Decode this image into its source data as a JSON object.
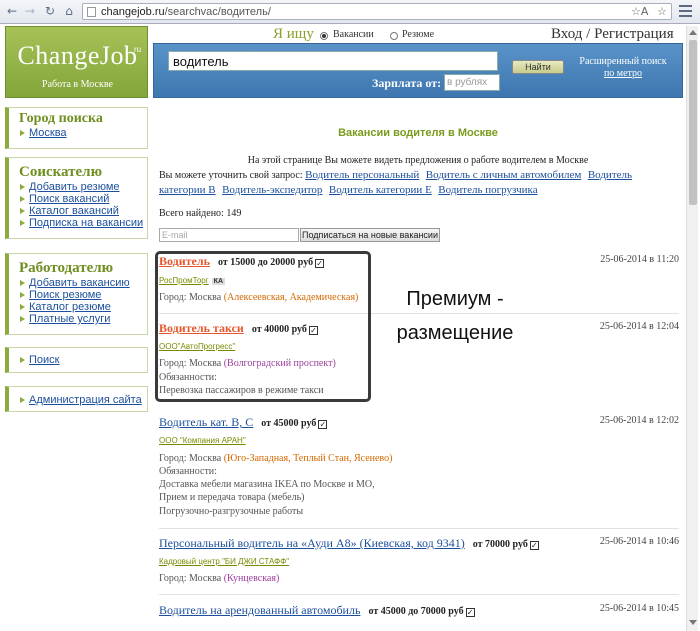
{
  "browser": {
    "url_domain": "changejob.ru",
    "url_path": "/searchvac/водитель/",
    "back_icon": "arrow-left-icon",
    "forward_icon": "arrow-right-icon",
    "reload_icon": "reload-icon",
    "home_icon": "home-icon",
    "translate_label": "☆A",
    "star": "☆"
  },
  "logo": {
    "name": "ChangeJob",
    "tld": "ru",
    "subtitle": "Работа в Москве"
  },
  "header": {
    "iam_label": "Я ищу",
    "radio_vacancies": "Вакансии",
    "radio_resume": "Резюме",
    "login_label": "Вход / Регистрация",
    "query_value": "водитель",
    "find_button": "Найти",
    "adv_search_line1": "Расширенный поиск",
    "adv_search_line2": "по метро",
    "salary_label": "Зарплата от:",
    "salary_placeholder": "в рублях"
  },
  "sidebar": {
    "city": {
      "title": "Город поиска",
      "items": [
        "Москва"
      ]
    },
    "seeker": {
      "title": "Соискателю",
      "items": [
        "Добавить резюме",
        "Поиск вакансий",
        "Каталог вакансий",
        "Подписка на вакансии"
      ]
    },
    "employer": {
      "title": "Работодателю",
      "items": [
        "Добавить вакансию",
        "Поиск резюме",
        "Каталог резюме",
        "Платные услуги"
      ]
    },
    "search": {
      "items": [
        "Поиск"
      ]
    },
    "admin": {
      "items": [
        "Администрация сайта"
      ]
    }
  },
  "main": {
    "heading": "Вакансии водителя в Москве",
    "intro": "На этой странице Вы можете видеть предложения о работе водителем в Москве",
    "refine_label": "Вы можете уточнить свой запрос:",
    "refine_links": [
      "Водитель персональный",
      "Водитель с личным автомобилем",
      "Водитель категории B",
      "Водитель-экспедитор",
      "Водитель категории E",
      "Водитель погрузчика"
    ],
    "total": "Всего найдено: 149",
    "email_placeholder": "E-mail",
    "subscribe_button": "Подписаться на новые вакансии",
    "premium_label": "Премиум - размещение"
  },
  "jobs": [
    {
      "title": "Водитель",
      "salary": "от 15000 до 20000 руб",
      "date": "25-06-2014 в 11:20",
      "company": "РосПромТорг",
      "company_tag": "КА",
      "city_label": "Город: Москва",
      "locations": "(Алексеевская, Академическая)",
      "premium": true
    },
    {
      "title": "Водитель такси",
      "salary": "от 40000 руб",
      "date": "25-06-2014 в 12:04",
      "company": "ООО\"АвтоПрогресс\"",
      "city_label": "Город: Москва",
      "locations": "(Волгоградский проспект)",
      "duties_label": "Обязанности:",
      "duties": "Перевозка пассажиров в режиме такси",
      "premium": true
    },
    {
      "title": "Водитель кат. B, C",
      "salary": "от 45000 руб",
      "date": "25-06-2014 в 12:02",
      "company": "ООО \"Компания АРАН\"",
      "city_label": "Город: Москва",
      "locations": "(Юго-Западная, Теплый Стан, Ясенево)",
      "duties_label": "Обязанности:",
      "duties_lines": [
        "Доставка мебели магазина IKEA по Москве и МО,",
        "Прием и передача товара (мебель)",
        "Погрузочно-разгрузочные работы"
      ],
      "premium": false
    },
    {
      "title": "Персональный водитель на «Ауди А8» (Киевская, код 9341)",
      "salary": "от 70000 руб",
      "date": "25-06-2014 в 10:46",
      "company": "Кадровый центр \"БИ ДЖИ СТАФФ\"",
      "city_label": "Город: Москва",
      "locations": "(Кунцевская)",
      "premium": false
    },
    {
      "title": "Водитель на арендованный автомобиль",
      "salary": "от 45000 до 70000 руб",
      "date": "25-06-2014 в 10:45",
      "company": "",
      "premium": false
    }
  ],
  "colors": {
    "accent_green": "#8bab3d",
    "panel_blue": "#4a85bd",
    "premium_orange": "#e4572e",
    "link_blue": "#1c4f9c"
  }
}
